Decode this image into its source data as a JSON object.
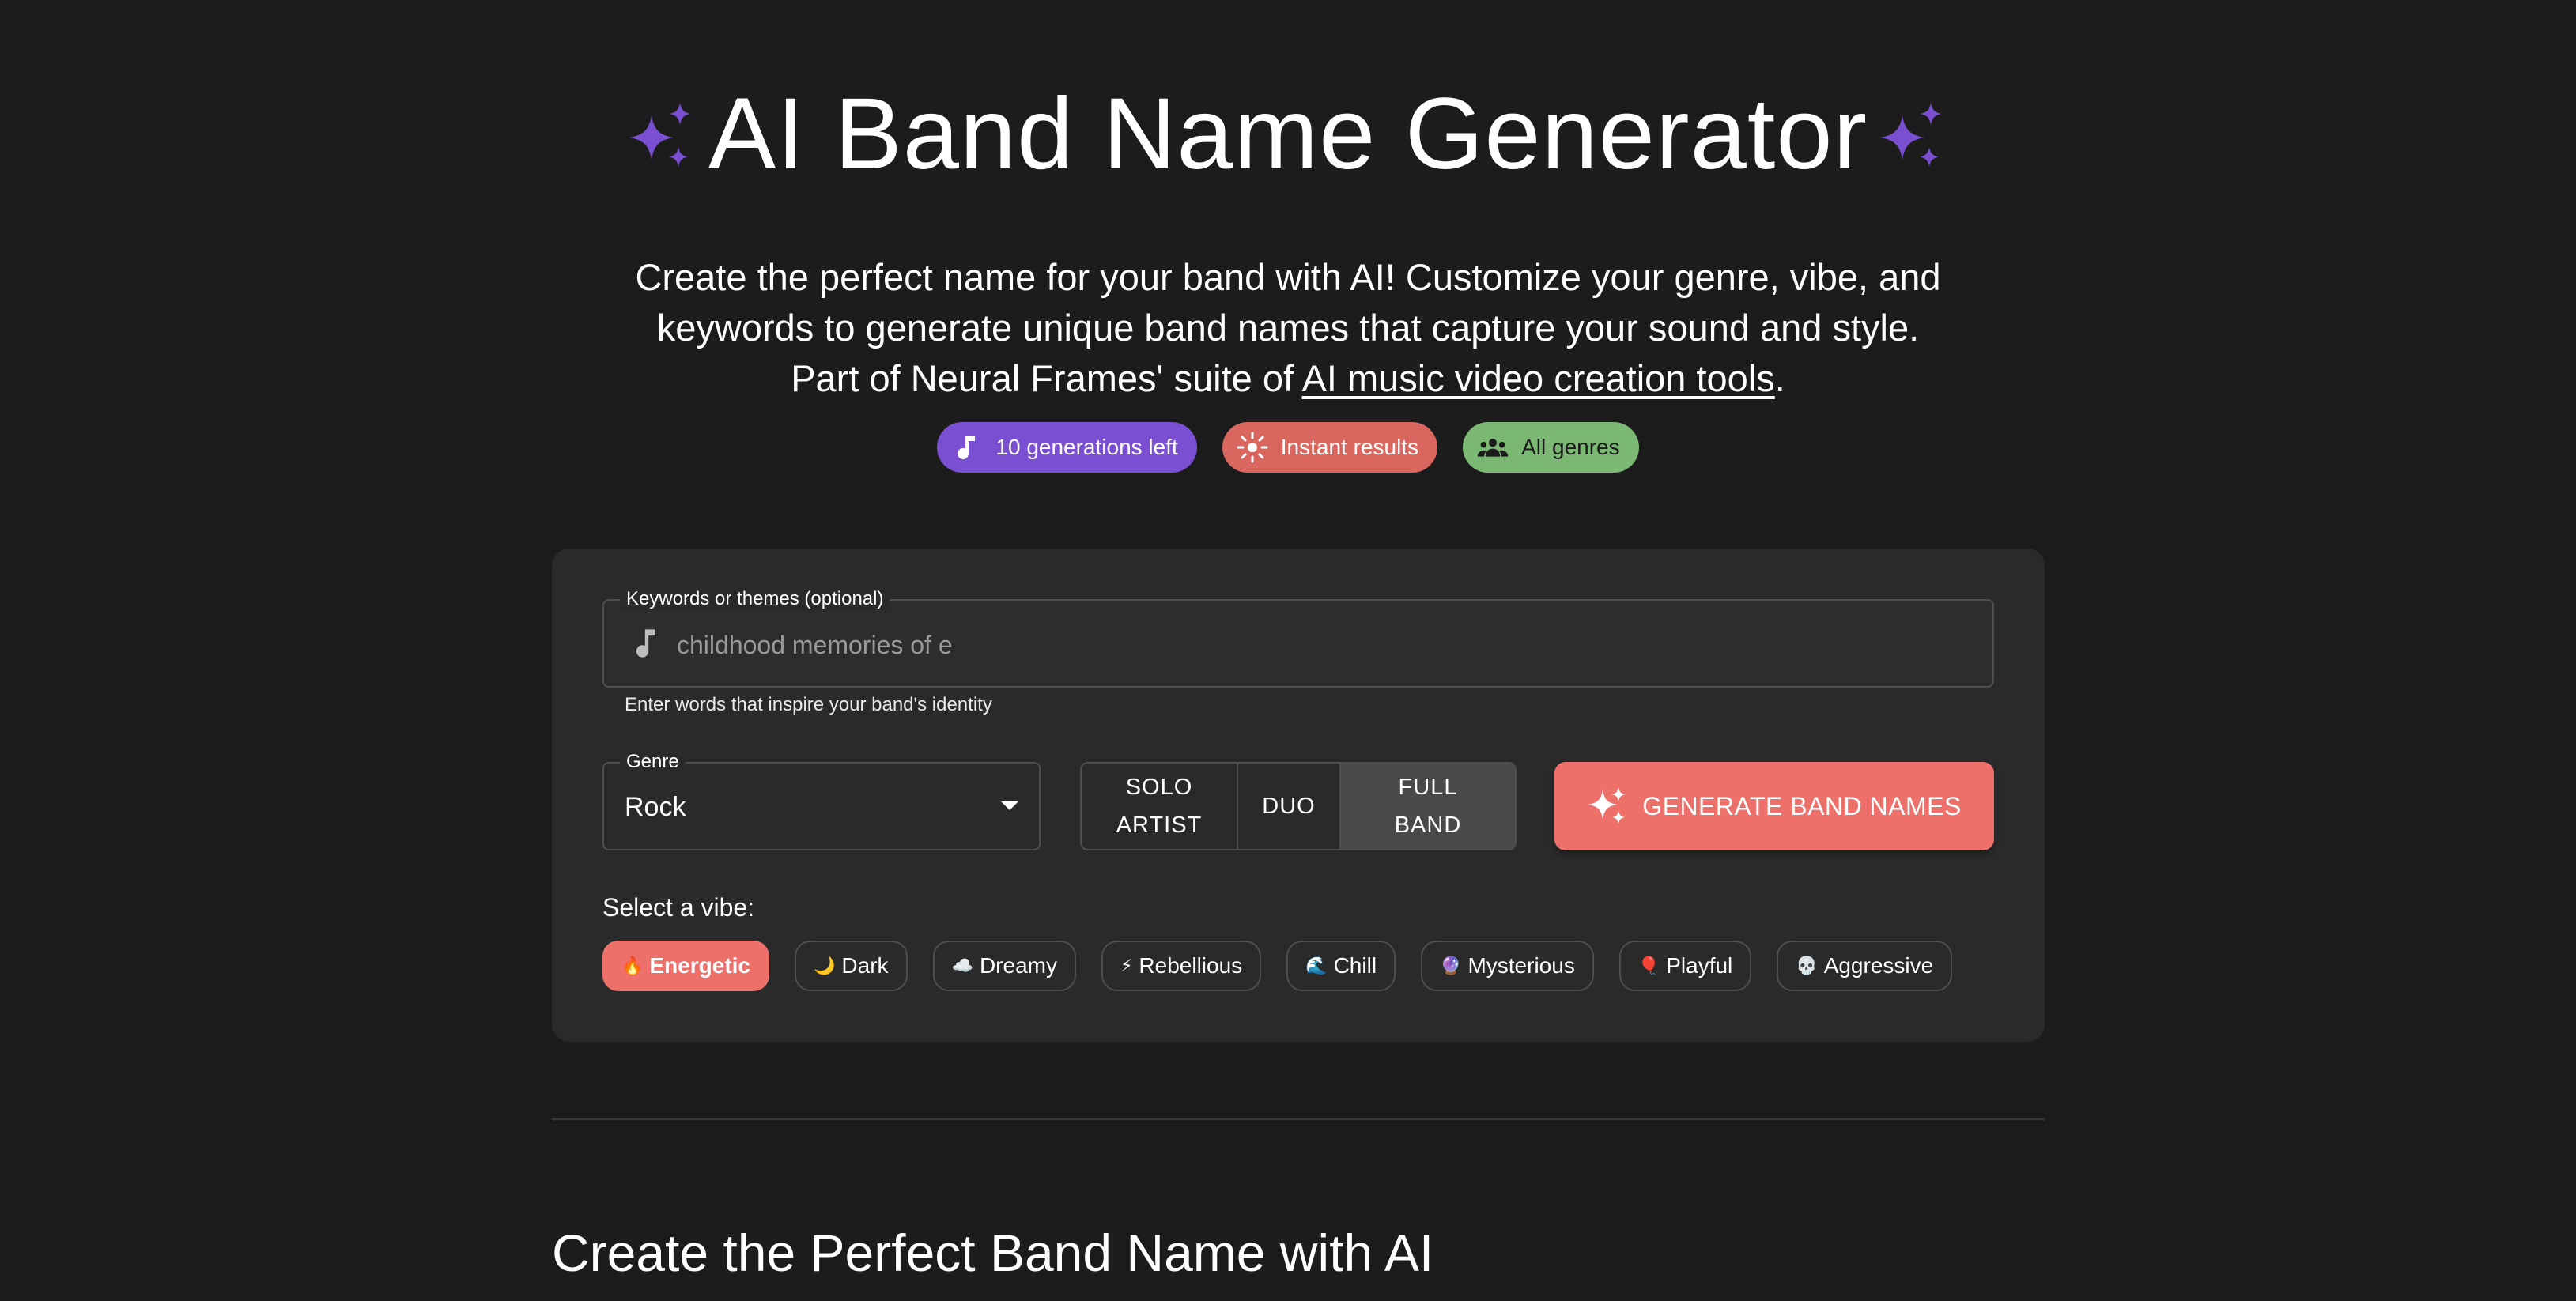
{
  "hero": {
    "title": "AI Band Name Generator",
    "subtitle_text": "Create the perfect name for your band with AI! Customize your genre, vibe, and keywords to generate unique band names that capture your sound and style. Part of Neural Frames' suite of ",
    "subtitle_link": "AI music video creation tools",
    "subtitle_end": "."
  },
  "badges": [
    {
      "label": "10 generations left",
      "icon": "music-note-icon",
      "color": "#7a4fd1"
    },
    {
      "label": "Instant results",
      "icon": "sun-icon",
      "color": "#d9675f"
    },
    {
      "label": "All genres",
      "icon": "group-icon",
      "color": "#7ab874"
    }
  ],
  "form": {
    "keywords_label": "Keywords or themes (optional)",
    "keywords_value": "",
    "keywords_placeholder": "childhood memories of e",
    "keywords_helper": "Enter words that inspire your band's identity",
    "genre_label": "Genre",
    "genre_value": "Rock",
    "band_types": [
      {
        "label": "SOLO ARTIST",
        "active": false
      },
      {
        "label": "DUO",
        "active": false
      },
      {
        "label": "FULL BAND",
        "active": true
      }
    ],
    "generate_label": "GENERATE BAND NAMES",
    "vibe_label": "Select a vibe:",
    "vibes": [
      {
        "emoji": "🔥",
        "label": "Energetic",
        "active": true
      },
      {
        "emoji": "🌙",
        "label": "Dark",
        "active": false
      },
      {
        "emoji": "☁️",
        "label": "Dreamy",
        "active": false
      },
      {
        "emoji": "⚡",
        "label": "Rebellious",
        "active": false
      },
      {
        "emoji": "🌊",
        "label": "Chill",
        "active": false
      },
      {
        "emoji": "🔮",
        "label": "Mysterious",
        "active": false
      },
      {
        "emoji": "🎈",
        "label": "Playful",
        "active": false
      },
      {
        "emoji": "💀",
        "label": "Aggressive",
        "active": false
      }
    ]
  },
  "section": {
    "title": "Create the Perfect Band Name with AI"
  },
  "colors": {
    "accent_purple": "#7a4fd1",
    "accent_coral": "#ed706b",
    "badge_green": "#7ab874",
    "background": "#1c1c1d",
    "card": "#2a2a2b"
  }
}
